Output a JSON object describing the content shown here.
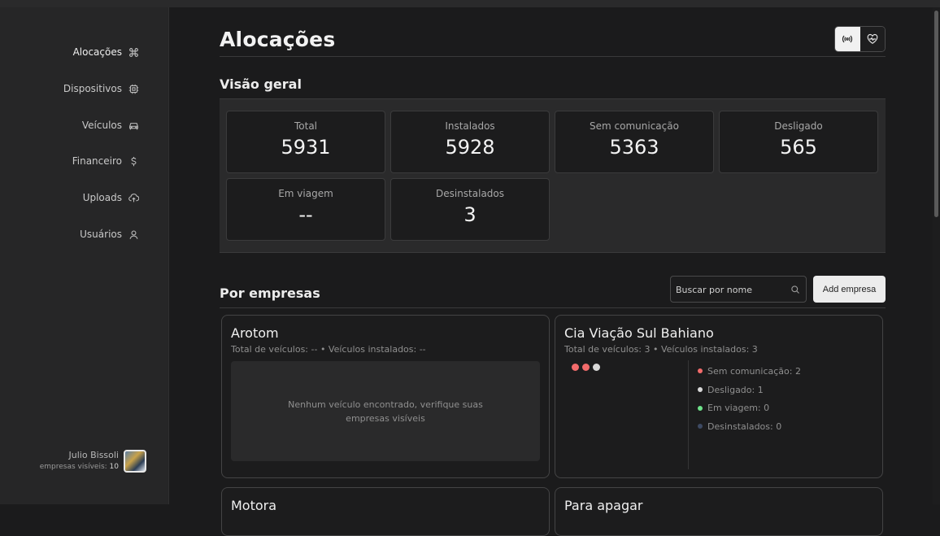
{
  "sidebar": {
    "items": [
      {
        "label": "Alocações",
        "icon": "command-icon"
      },
      {
        "label": "Dispositivos",
        "icon": "chip-icon"
      },
      {
        "label": "Veículos",
        "icon": "car-icon"
      },
      {
        "label": "Financeiro",
        "icon": "dollar-icon"
      },
      {
        "label": "Uploads",
        "icon": "cloud-upload-icon"
      },
      {
        "label": "Usuários",
        "icon": "user-icon"
      }
    ],
    "user": {
      "name": "Julio Bissoli",
      "visible_label": "empresas visíveis:",
      "visible_count": "10"
    }
  },
  "page": {
    "title": "Alocações"
  },
  "view_toggle": {
    "icons": [
      "broadcast-icon",
      "heart-pulse-icon"
    ],
    "selected": "broadcast-icon"
  },
  "overview": {
    "title": "Visão geral",
    "stats": [
      {
        "label": "Total",
        "value": "5931"
      },
      {
        "label": "Instalados",
        "value": "5928"
      },
      {
        "label": "Sem comunicação",
        "value": "5363"
      },
      {
        "label": "Desligado",
        "value": "565"
      },
      {
        "label": "Em viagem",
        "value": "--"
      },
      {
        "label": "Desinstalados",
        "value": "3"
      }
    ]
  },
  "empresas": {
    "title": "Por empresas",
    "search_placeholder": "Buscar por nome",
    "add_label": "Add empresa",
    "cards": [
      {
        "name": "Arotom",
        "summary": "Total de veículos: -- • Veículos instalados: --",
        "empty_message": "Nenhum veículo encontrado, verifique suas empresas visíveis"
      },
      {
        "name": "Cia Viação Sul Bahiano",
        "summary": "Total de veículos: 3 • Veículos instalados: 3",
        "dots": [
          "#f26b6b",
          "#f26b6b",
          "#d9d9d9"
        ],
        "legend": [
          {
            "label": "Sem comunicação: 2",
            "color": "#f26b6b"
          },
          {
            "label": "Desligado: 1",
            "color": "#d9d9d9"
          },
          {
            "label": "Em viagem: 0",
            "color": "#6ee38a"
          },
          {
            "label": "Desinstalados: 0",
            "color": "#3d4a63"
          }
        ]
      },
      {
        "name": "Motora"
      },
      {
        "name": "Para apagar"
      }
    ]
  }
}
